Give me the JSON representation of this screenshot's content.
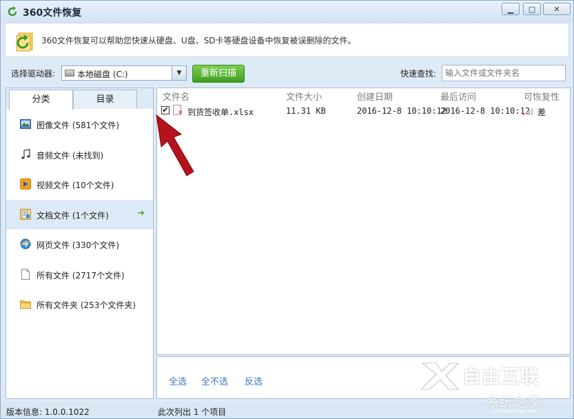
{
  "window": {
    "title": "360文件恢复",
    "controls": {
      "minimize": "▁",
      "maximize": "□",
      "close": "✕"
    }
  },
  "banner": {
    "text": "360文件恢复可以帮助您快速从硬盘、U盘、SD卡等硬盘设备中恢复被误删除的文件。"
  },
  "toolbar": {
    "drive_label": "选择驱动器:",
    "drive_value": "本地磁盘 (C:)",
    "rescan_label": "重新扫描",
    "search_label": "快速查找:",
    "search_placeholder": "输入文件或文件夹名"
  },
  "sidebar": {
    "tabs": [
      {
        "label": "分类",
        "active": true
      },
      {
        "label": "目录",
        "active": false
      }
    ],
    "items": [
      {
        "label": "图像文件 (581个文件)",
        "icon": "image-icon",
        "selected": false
      },
      {
        "label": "音频文件 (未找到)",
        "icon": "music-note-icon",
        "selected": false
      },
      {
        "label": "视频文件 (10个文件)",
        "icon": "video-icon",
        "selected": false
      },
      {
        "label": "文档文件 (1个文件)",
        "icon": "document-icon",
        "selected": true
      },
      {
        "label": "网页文件 (330个文件)",
        "icon": "web-icon",
        "selected": false
      },
      {
        "label": "所有文件 (2717个文件)",
        "icon": "file-icon",
        "selected": false
      },
      {
        "label": "所有文件夹 (253个文件夹)",
        "icon": "folder-icon",
        "selected": false
      }
    ]
  },
  "file_list": {
    "columns": [
      "文件名",
      "文件大小",
      "创建日期",
      "最后访问",
      "可恢复性"
    ],
    "rows": [
      {
        "checked": true,
        "name": "到货签收单.xlsx",
        "size": "11.31 KB",
        "created": "2016-12-8 10:10:12",
        "accessed": "2016-12-8 10:10:12",
        "recoverability": "差"
      }
    ]
  },
  "actions": {
    "select_all": "全选",
    "select_none": "全不选",
    "invert": "反选"
  },
  "statusbar": {
    "version": "版本信息: 1.0.0.1022",
    "count": "此次列出 1 个项目"
  },
  "watermark": {
    "brand": "自由互联",
    "sub": "系统之家",
    "domain": "XITONGZHIJIA.NET"
  },
  "colors": {
    "accent_green": "#3f9e24",
    "link_blue": "#3a76c4",
    "annotation_red": "#b5121b",
    "recoverability_bad": "#e53b2f"
  }
}
